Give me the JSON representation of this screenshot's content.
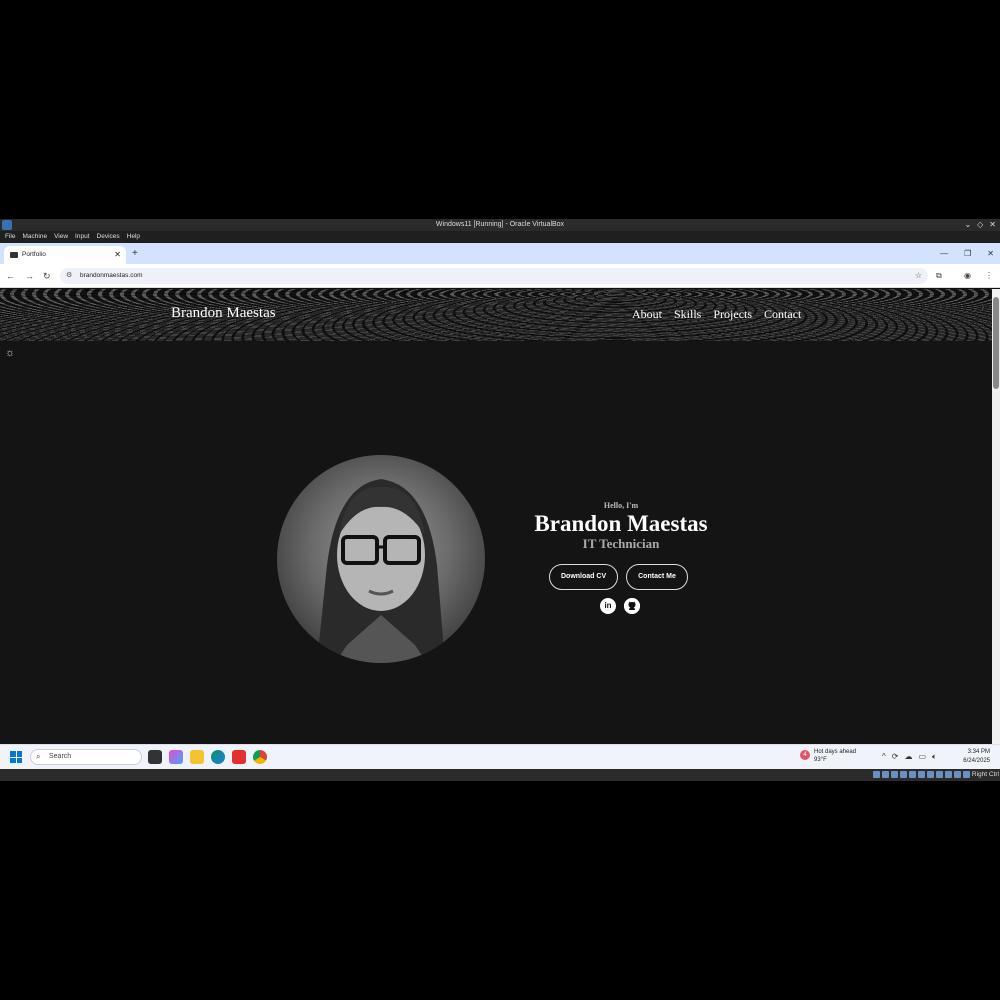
{
  "vm": {
    "window_title": "Windows11 [Running] - Oracle VirtualBox",
    "menu": [
      "File",
      "Machine",
      "View",
      "Input",
      "Devices",
      "Help"
    ],
    "host_key": "Right Ctrl"
  },
  "browser": {
    "tab_title": "Portfolio",
    "url": "brandonmaestas.com"
  },
  "site": {
    "brand": "Brandon Maestas",
    "nav": [
      "About",
      "Skills",
      "Projects",
      "Contact"
    ],
    "greeting": "Hello, I'm",
    "name": "Brandon Maestas",
    "role": "IT Technician",
    "buttons": {
      "download_cv": "Download CV",
      "contact_me": "Contact Me"
    },
    "social": [
      {
        "icon": "linkedin-icon",
        "glyph": "in"
      },
      {
        "icon": "github-icon",
        "glyph": "gh"
      }
    ]
  },
  "taskbar": {
    "search_placeholder": "Search",
    "weather": {
      "headline": "Hot days ahead",
      "temp": "93°F",
      "badge": "4"
    },
    "time": "3:34 PM",
    "date": "6/24/2025"
  },
  "colors": {
    "page_bg": "#141414",
    "accent_blue": "#0078d4"
  }
}
